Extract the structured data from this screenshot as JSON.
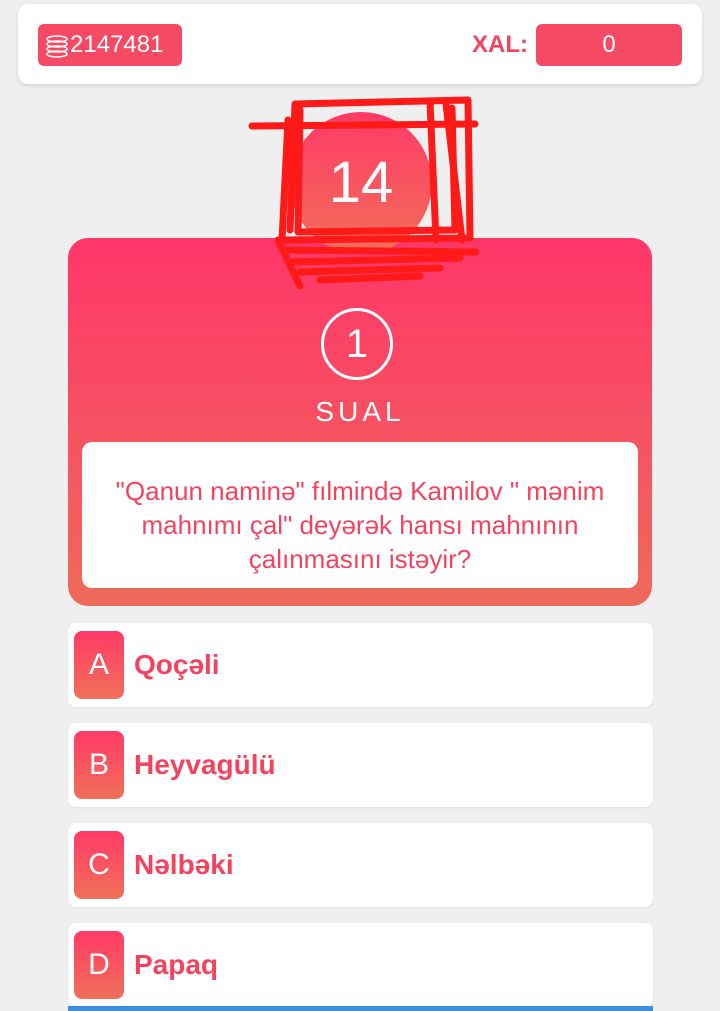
{
  "header": {
    "coins_icon": "coins-stack-icon",
    "coins_value": "2147481",
    "score_label": "XAL:",
    "score_value": "0"
  },
  "timer": {
    "value": "14"
  },
  "question": {
    "number": "1",
    "label": "SUAL",
    "text": "\"Qanun naminə\" fılmində Kamilov \" mənim mahnımı çal\" deyərək hansı mahnının çalınmasını istəyir?"
  },
  "answers": [
    {
      "letter": "A",
      "text": "Qoçəli"
    },
    {
      "letter": "B",
      "text": "Heyvagülü"
    },
    {
      "letter": "C",
      "text": "Nəlbəki"
    },
    {
      "letter": "D",
      "text": "Papaq"
    }
  ],
  "colors": {
    "accent": "#f4435e",
    "gradient_top": "#ff3669",
    "gradient_bottom": "#ef6a5b",
    "background": "#efefef",
    "scribble": "#ff1a1a"
  }
}
